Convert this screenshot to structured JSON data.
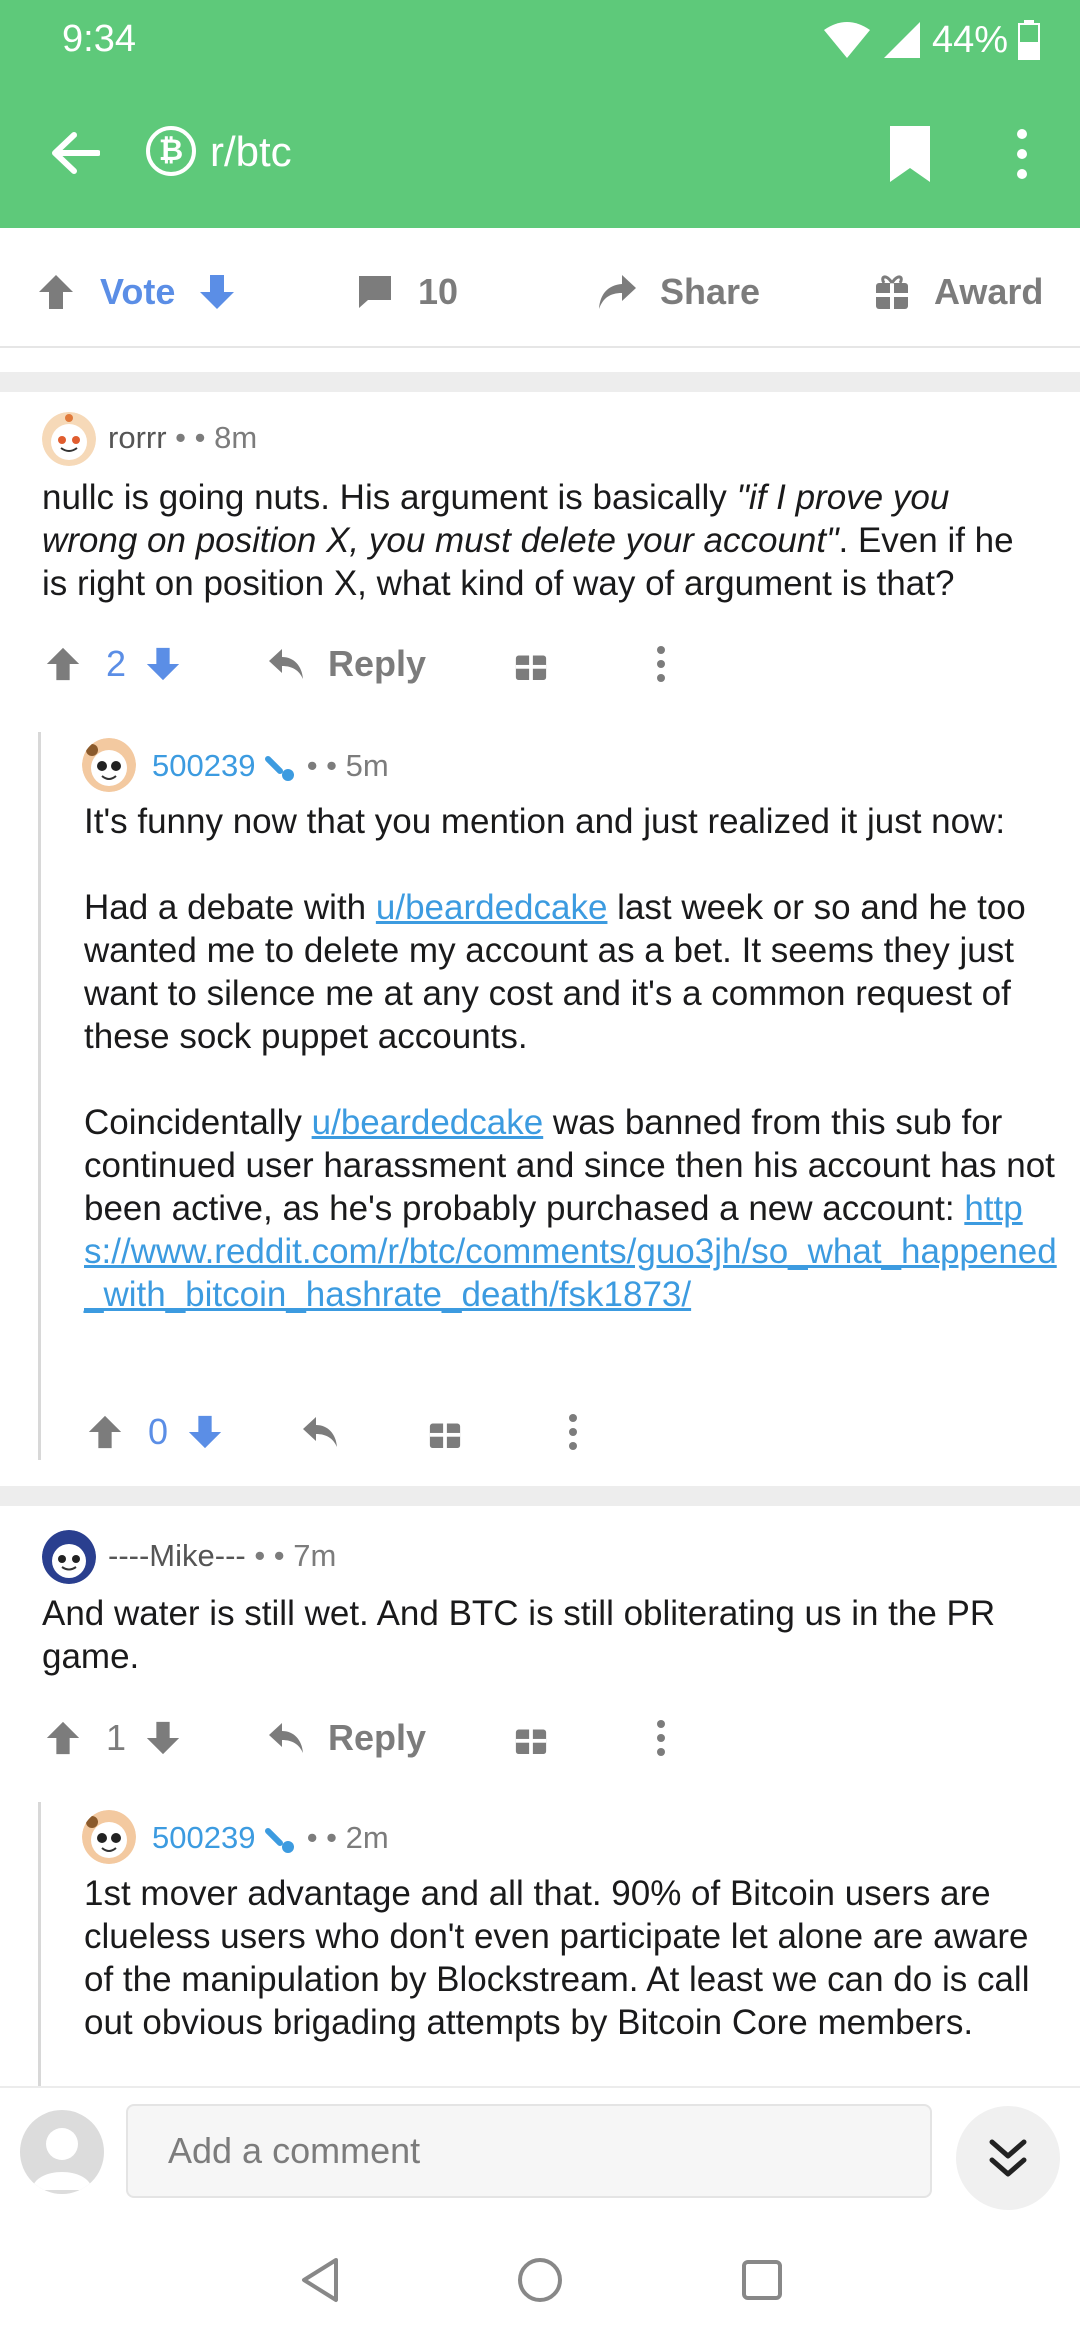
{
  "status_bar": {
    "time": "9:34",
    "battery": "44%"
  },
  "toolbar": {
    "subreddit": "r/btc",
    "sub_icon_glyph": "₿"
  },
  "post_actions": {
    "vote": "Vote",
    "comments": "10",
    "share": "Share",
    "award": "Award"
  },
  "comments": [
    {
      "author": "rorrr",
      "time": "8m",
      "body_pre": "nullc is going nuts. His argument is basically ",
      "body_em": "\"if I prove you wrong on position X, you must delete your account\"",
      "body_post": ". Even if he is right on position X, what kind of way of argument is that?",
      "score": "2",
      "reply": "Reply"
    },
    {
      "author": "500239",
      "time": "5m",
      "p1": "It's funny now that you mention and just realized it just now:",
      "p2_pre": "Had a debate with ",
      "p2_link": "u/beardedcake",
      "p2_post": " last week or so and he too wanted me to delete my account as a bet. It seems they just want to silence me at any cost and it's a common request of these sock puppet accounts.",
      "p3_pre": "Coincidentally ",
      "p3_link": "u/beardedcake",
      "p3_mid": " was banned from this sub for continued user harassment and since then his account has not been active, as he's probably purchased a new account: ",
      "p3_url": "https://www.reddit.com/r/btc/comments/guo3jh/so_what_happened_with_bitcoin_hashrate_death/fsk1873/",
      "score": "0"
    },
    {
      "author": "----Mike---",
      "time": "7m",
      "body": "And water is still wet. And BTC is still obliterating us in the PR game.",
      "score": "1",
      "reply": "Reply"
    },
    {
      "author": "500239",
      "time": "2m",
      "body": "1st mover advantage and all that. 90% of Bitcoin users are clueless users who don't even participate let alone are aware of the manipulation by Blockstream. At least we can do is call out obvious brigading attempts by Bitcoin Core members."
    }
  ],
  "comment_bar": {
    "placeholder": "Add a comment"
  },
  "colors": {
    "header": "#5ec97a",
    "link": "#3c9be0",
    "vote_blue": "#5b8ee6",
    "mod_icon": "#3c9be0"
  }
}
